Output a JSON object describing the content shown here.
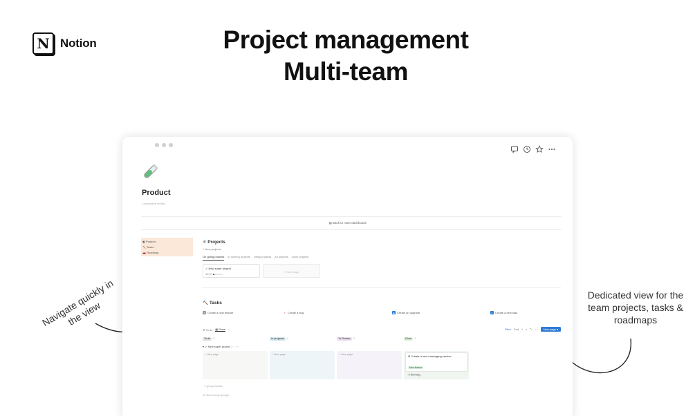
{
  "brand": {
    "logo_letter": "N",
    "name": "Notion"
  },
  "headline": {
    "line1": "Project management",
    "line2": "Multi-team"
  },
  "callouts": {
    "left": "Navigate quickly in the view",
    "right": "Dedicated view for the team projects, tasks & roadmaps"
  },
  "window": {
    "top_icons": [
      "comment-icon",
      "clock-icon",
      "star-icon",
      "more-icon"
    ],
    "page_icon": "test-tube-icon",
    "page_title": "Product",
    "page_subtitle": "Competitive review",
    "back_link": "Back to main dashboard"
  },
  "sidebar": {
    "items": [
      {
        "icon": "▣",
        "label": "Projects"
      },
      {
        "icon": "🔨",
        "label": "Tasks"
      },
      {
        "icon": "🚗",
        "label": "Roadmap"
      }
    ]
  },
  "projects": {
    "title": "Projects",
    "new_label": "New projects",
    "tabs": [
      "On going projects",
      "In coming projects",
      "Delay projects",
      "All projects",
      "Done projects"
    ],
    "card": {
      "title": "New super project",
      "progress_label": "10 %",
      "progress": 0.1
    },
    "new_page": "New page"
  },
  "tasks": {
    "title": "Tasks",
    "actions": [
      {
        "icon": "+",
        "label": "Create a new feature",
        "color": "#9b9a97"
      },
      {
        "icon": "×",
        "label": "Create a bug",
        "color": "#e03e3e"
      },
      {
        "icon": "▲",
        "label": "Create an upgrade",
        "color": "#2e7bd6"
      },
      {
        "icon": "✓",
        "label": "Create a new task",
        "color": "#2e7bd6"
      }
    ],
    "view_tabs": [
      "To do",
      "Done"
    ],
    "toolbar": {
      "filter": "Filter",
      "sort": "Sort",
      "new_page": "New page"
    },
    "columns": [
      {
        "label": "To do",
        "count": "0",
        "color": "#e3e2e0",
        "body": "#f7f7f5"
      },
      {
        "label": "In progress",
        "count": "0",
        "color": "#d3e5ef",
        "body": "#eef5f9"
      },
      {
        "label": "To Review",
        "count": "0",
        "color": "#e8deee",
        "body": "#f6f2f9"
      },
      {
        "label": "Done",
        "count": "1",
        "color": "#dbeddb",
        "body": "#eff6f0"
      }
    ],
    "group": {
      "title": "New super project",
      "count": "1"
    },
    "new_page": "New page",
    "done_card": {
      "title": "Create a new messaging service",
      "tag": "New feature",
      "sub": "Product"
    },
    "footer": [
      "1 group hidden",
      "Hide empty groups"
    ]
  }
}
